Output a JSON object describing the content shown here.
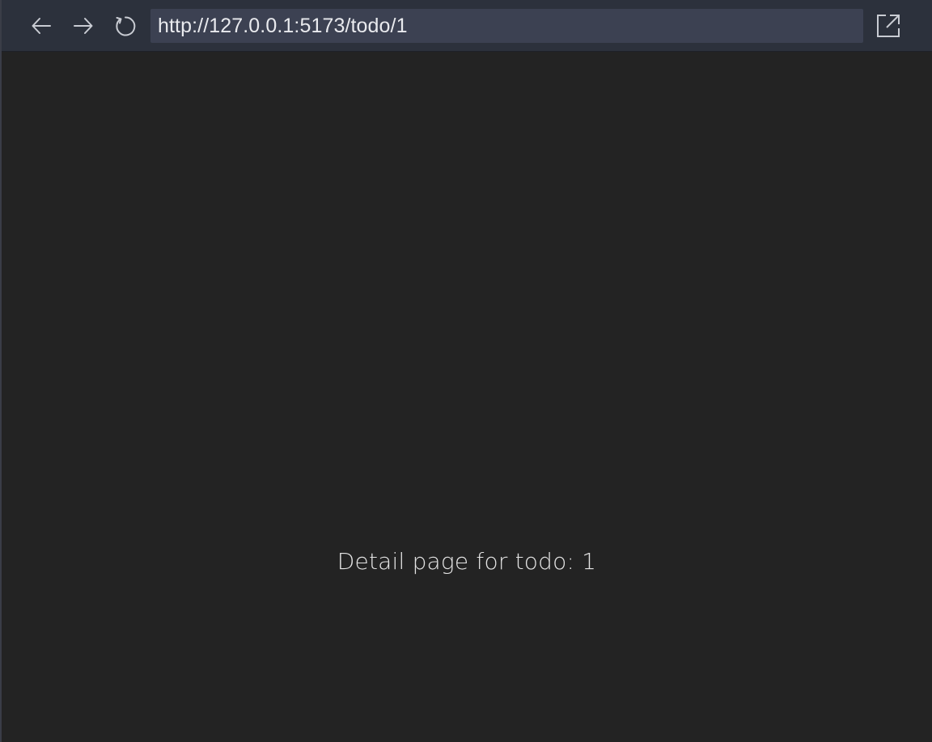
{
  "toolbar": {
    "back_icon": "arrow-left-icon",
    "forward_icon": "arrow-right-icon",
    "reload_icon": "reload-icon",
    "url": "http://127.0.0.1:5173/todo/1",
    "external_icon": "open-external-icon"
  },
  "page": {
    "text": "Detail page for todo: 1"
  },
  "colors": {
    "toolbar_bg": "#2c313c",
    "url_bg": "#3c4152",
    "page_bg": "#232323",
    "text": "#e4e4e4"
  }
}
